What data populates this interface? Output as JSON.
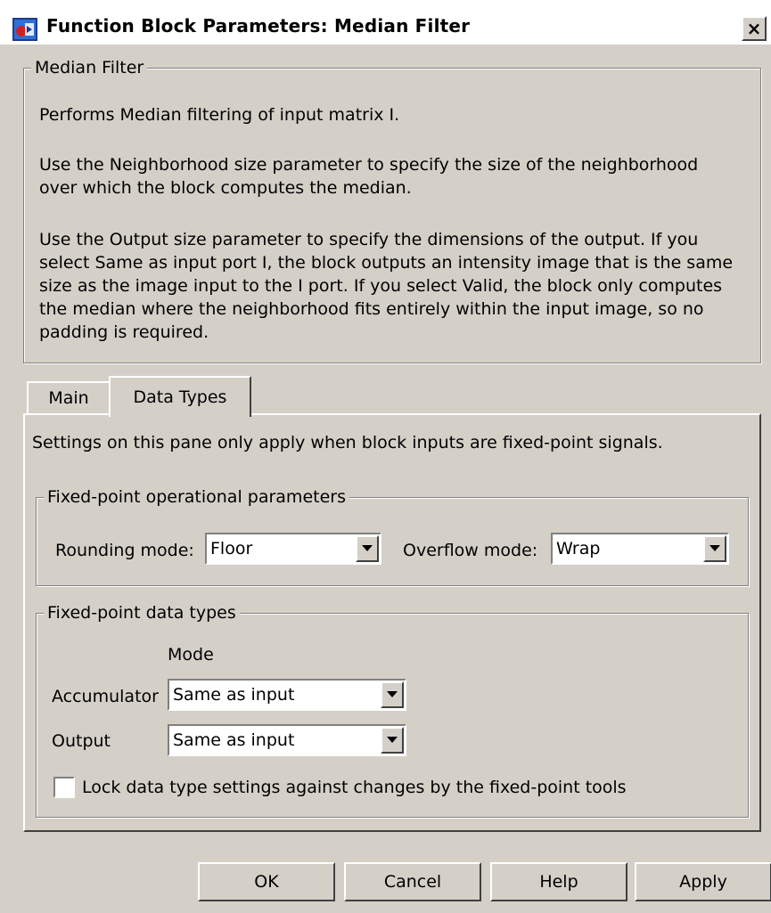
{
  "window": {
    "title": "Function Block Parameters: Median Filter",
    "close_glyph": "×"
  },
  "block": {
    "group_label": "Median Filter",
    "description": [
      "Performs Median filtering of input matrix I.",
      "Use the Neighborhood size parameter to specify the size of the neighborhood\nover which the block computes the median.",
      "Use the Output size parameter to specify the dimensions of the output. If you\nselect Same as input port I, the block outputs an intensity image that is the same\nsize as the image input to the I port. If you select Valid, the block only computes\nthe median where the neighborhood fits entirely within the input image, so no\npadding is required."
    ]
  },
  "tabs": [
    {
      "label": "Main",
      "selected": false
    },
    {
      "label": "Data Types",
      "selected": true
    }
  ],
  "data_types": {
    "info": "Settings on this pane only apply when block inputs are fixed-point signals.",
    "operational": {
      "group_label": "Fixed-point operational parameters",
      "rounding_label": "Rounding mode:",
      "rounding_value": "Floor",
      "overflow_label": "Overflow mode:",
      "overflow_value": "Wrap"
    },
    "types": {
      "group_label": "Fixed-point data types",
      "mode_header": "Mode",
      "accumulator_label": "Accumulator",
      "accumulator_value": "Same as input",
      "output_label": "Output",
      "output_value": "Same as input",
      "lock_label": "Lock data type settings against changes by the fixed-point tools",
      "lock_checked": false
    }
  },
  "buttons": {
    "ok": "OK",
    "cancel": "Cancel",
    "help": "Help",
    "apply": "Apply"
  },
  "colors": {
    "dialog_bg": "#d4d0c8",
    "title_bg": "#ffffff"
  }
}
